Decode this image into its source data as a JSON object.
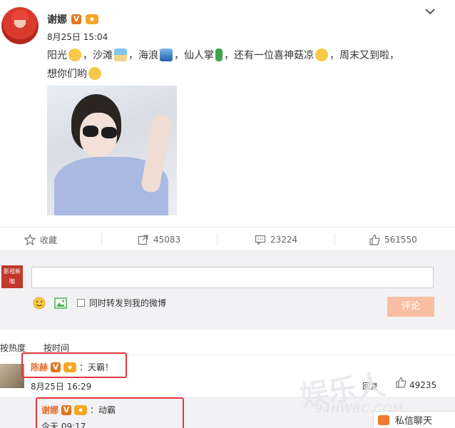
{
  "post": {
    "username": "谢娜",
    "v_badge": "V",
    "time": "8月25日 15:04",
    "text": {
      "seg1": "阳光",
      "seg2": "，沙滩",
      "seg3": "，海浪",
      "seg4": "，仙人掌",
      "seg5": "，还有一位喜神菇凉",
      "seg6": "，周末又到啦，",
      "seg7": "想你们哟"
    }
  },
  "actions": {
    "favorite": "收藏",
    "reposts": "45083",
    "comments": "23224",
    "likes": "561550"
  },
  "comment_box": {
    "logo_text": "影视新咖",
    "checkbox_label": "同时转发到我的微博",
    "submit": "评论"
  },
  "sort": {
    "by_hot": "按热度",
    "by_time": "按时间"
  },
  "comments": [
    {
      "name": "陈赫",
      "v_badge": "V",
      "text": "：天霸！",
      "time": "8月25日 16:29",
      "reply_label": "回复",
      "likes": "49235"
    }
  ],
  "reply": {
    "name": "谢娜",
    "v_badge": "V",
    "text": "：动霸",
    "time": "今天 09:17"
  },
  "watermark": {
    "main": "娱乐人",
    "sub": "94HWBC.COM"
  },
  "chat_bar": {
    "label": "私信聊天"
  },
  "colors": {
    "name_orange": "#e86d28",
    "highlight_red": "#e0383e",
    "submit_disabled": "#f9bfa4"
  }
}
